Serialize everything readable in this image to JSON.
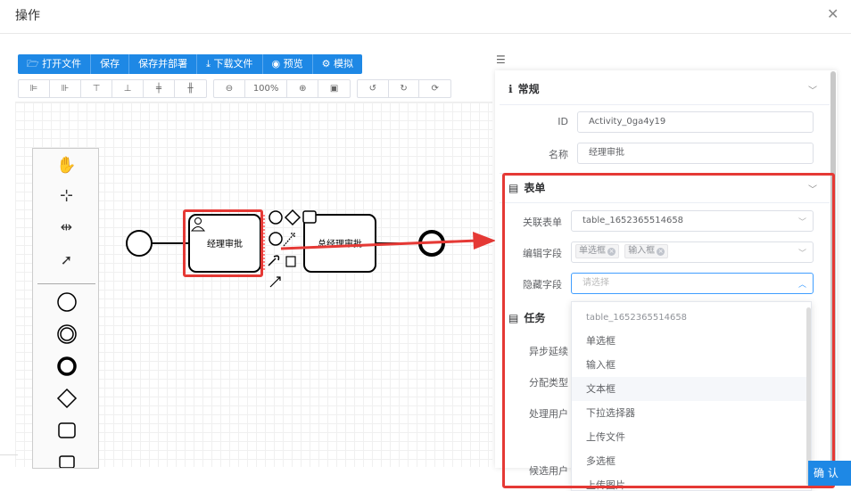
{
  "dialog": {
    "title": "操作",
    "close_icon": "close-icon",
    "confirm_label": "确 认"
  },
  "toolbar": {
    "buttons": [
      {
        "icon": "folder-open-icon",
        "label": "打开文件"
      },
      {
        "icon": "",
        "label": "保存"
      },
      {
        "icon": "",
        "label": "保存并部署"
      },
      {
        "icon": "download-icon",
        "label": "下载文件"
      },
      {
        "icon": "eye-icon",
        "label": "预览"
      },
      {
        "icon": "gear-icon",
        "label": "模拟"
      }
    ]
  },
  "zoom": {
    "level": "100%"
  },
  "diagram": {
    "task1_label": "经理审批",
    "task2_label": "总经理审批"
  },
  "panel": {
    "general": {
      "title": "常规",
      "id_label": "ID",
      "id_value": "Activity_0ga4y19",
      "name_label": "名称",
      "name_value": "经理审批"
    },
    "form": {
      "title": "表单",
      "linked_label": "关联表单",
      "linked_value": "table_1652365514658",
      "edit_label": "编辑字段",
      "edit_tags": [
        "单选框",
        "输入框"
      ],
      "hidden_label": "隐藏字段",
      "hidden_placeholder": "请选择"
    },
    "task": {
      "title": "任务",
      "async_label": "异步延续",
      "assign_label": "分配类型",
      "user_label": "处理用户",
      "candidate_label": "候选用户"
    }
  },
  "dropdown": {
    "group": "table_1652365514658",
    "options": [
      "单选框",
      "输入框",
      "文本框",
      "下拉选择器",
      "上传文件",
      "多选框",
      "上传图片"
    ]
  },
  "colors": {
    "accent": "#1e88e5",
    "highlight": "#e53935"
  }
}
